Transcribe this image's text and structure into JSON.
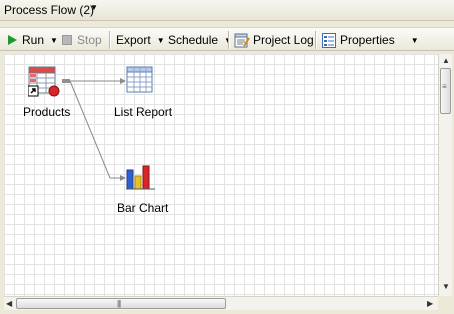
{
  "window": {
    "title": "Process Flow (2)"
  },
  "toolbar": {
    "run": "Run",
    "stop": "Stop",
    "export": "Export",
    "schedule": "Schedule",
    "project_log": "Project Log",
    "properties": "Properties"
  },
  "nodes": {
    "products": "Products",
    "list_report": "List Report",
    "bar_chart": "Bar Chart"
  },
  "colors": {
    "accent_run": "#1d9a2a",
    "chart_red": "#d7262b",
    "chart_blue": "#2f5fd0",
    "chart_yellow": "#e6c12a"
  }
}
